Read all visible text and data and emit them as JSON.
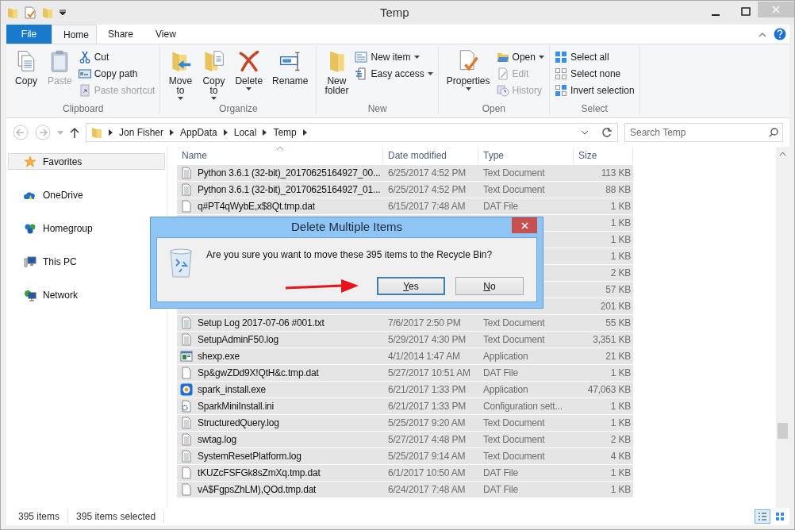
{
  "window": {
    "title": "Temp"
  },
  "ribbon_tabs": [
    {
      "label": "File",
      "kind": "file",
      "selected": false
    },
    {
      "label": "Home",
      "kind": "tab",
      "selected": true
    },
    {
      "label": "Share",
      "kind": "tab",
      "selected": false
    },
    {
      "label": "View",
      "kind": "tab",
      "selected": false
    }
  ],
  "ribbon_groups": [
    {
      "label": "Clipboard",
      "columns": [
        {
          "kind": "large",
          "items": [
            {
              "lines": [
                "Copy"
              ],
              "dropdown": false,
              "disabled": false
            }
          ]
        },
        {
          "kind": "large",
          "items": [
            {
              "lines": [
                "Paste"
              ],
              "dropdown": false,
              "disabled": true
            }
          ]
        },
        {
          "kind": "small",
          "items": [
            {
              "label": "Cut",
              "dropdown": false,
              "disabled": false
            },
            {
              "label": "Copy path",
              "dropdown": false,
              "disabled": false
            },
            {
              "label": "Paste shortcut",
              "dropdown": false,
              "disabled": true
            }
          ]
        }
      ]
    },
    {
      "label": "Organize",
      "columns": [
        {
          "kind": "large",
          "items": [
            {
              "lines": [
                "Move",
                "to"
              ],
              "dropdown": true,
              "disabled": false
            }
          ]
        },
        {
          "kind": "large",
          "items": [
            {
              "lines": [
                "Copy",
                "to"
              ],
              "dropdown": true,
              "disabled": false
            }
          ]
        },
        {
          "kind": "large",
          "items": [
            {
              "lines": [
                "Delete"
              ],
              "dropdown": true,
              "disabled": false
            }
          ]
        },
        {
          "kind": "large",
          "items": [
            {
              "lines": [
                "Rename"
              ],
              "dropdown": false,
              "disabled": false
            }
          ]
        }
      ]
    },
    {
      "label": "New",
      "columns": [
        {
          "kind": "large",
          "items": [
            {
              "lines": [
                "New",
                "folder"
              ],
              "dropdown": false,
              "disabled": false
            }
          ]
        },
        {
          "kind": "small",
          "items": [
            {
              "label": "New item",
              "dropdown": true,
              "disabled": false
            },
            {
              "label": "Easy access",
              "dropdown": true,
              "disabled": false
            }
          ]
        }
      ]
    },
    {
      "label": "Open",
      "columns": [
        {
          "kind": "large",
          "items": [
            {
              "lines": [
                "Properties"
              ],
              "dropdown": true,
              "disabled": false
            }
          ]
        },
        {
          "kind": "small",
          "items": [
            {
              "label": "Open",
              "dropdown": true,
              "disabled": false
            },
            {
              "label": "Edit",
              "dropdown": false,
              "disabled": true
            },
            {
              "label": "History",
              "dropdown": false,
              "disabled": true
            }
          ]
        }
      ]
    },
    {
      "label": "Select",
      "columns": [
        {
          "kind": "small",
          "items": [
            {
              "label": "Select all",
              "dropdown": false,
              "disabled": false
            },
            {
              "label": "Select none",
              "dropdown": false,
              "disabled": false
            },
            {
              "label": "Invert selection",
              "dropdown": false,
              "disabled": false
            }
          ]
        }
      ]
    }
  ],
  "address": {
    "crumbs": [
      "Jon Fisher",
      "AppData",
      "Local",
      "Temp"
    ]
  },
  "search": {
    "placeholder": "Search Temp"
  },
  "nav": [
    {
      "label": "Favorites",
      "kind": "star",
      "selected": true
    },
    {
      "label": "OneDrive",
      "kind": "cloud",
      "selected": false
    },
    {
      "label": "Homegroup",
      "kind": "group",
      "selected": false
    },
    {
      "label": "This PC",
      "kind": "pc",
      "selected": false
    },
    {
      "label": "Network",
      "kind": "network",
      "selected": false
    }
  ],
  "columns": [
    "Name",
    "Date modified",
    "Type",
    "Size"
  ],
  "rows": [
    {
      "kind": "text",
      "name": "Python 3.6.1 (32-bit)_20170625164927_00...",
      "date": "6/25/2017 4:52 PM",
      "type": "Text Document",
      "size": "113 KB",
      "selected": true
    },
    {
      "kind": "text",
      "name": "Python 3.6.1 (32-bit)_20170625164927_01...",
      "date": "6/25/2017 4:52 PM",
      "type": "Text Document",
      "size": "88 KB",
      "selected": true
    },
    {
      "kind": "dat",
      "name": "q#PT4qWybE,x$8Qt.tmp.dat",
      "date": "6/15/2017 7:48 AM",
      "type": "DAT File",
      "size": "1 KB",
      "selected": true
    },
    {
      "kind": "hidden",
      "size": "1 KB",
      "selected": true
    },
    {
      "kind": "hidden",
      "size": "1 KB",
      "selected": true
    },
    {
      "kind": "hidden",
      "size": "1 KB",
      "selected": true
    },
    {
      "kind": "hidden",
      "size": "2 KB",
      "selected": true
    },
    {
      "kind": "hidden",
      "size": "57 KB",
      "selected": true
    },
    {
      "kind": "hidden",
      "size": "201 KB",
      "selected": true
    },
    {
      "kind": "text",
      "name": "Setup Log 2017-07-06 #001.txt",
      "date": "7/6/2017 2:50 PM",
      "type": "Text Document",
      "size": "55 KB",
      "selected": true
    },
    {
      "kind": "text",
      "name": "SetupAdminF50.log",
      "date": "5/29/2017 4:30 PM",
      "type": "Text Document",
      "size": "3,351 KB",
      "selected": true
    },
    {
      "kind": "app",
      "name": "shexp.exe",
      "date": "4/1/2014 1:47 AM",
      "type": "Application",
      "size": "21 KB",
      "selected": true
    },
    {
      "kind": "dat",
      "name": "Sp&gwZDd9X!QtH&c.tmp.dat",
      "date": "5/27/2017 10:51 AM",
      "type": "DAT File",
      "size": "1 KB",
      "selected": true
    },
    {
      "kind": "installer",
      "name": "spark_install.exe",
      "date": "6/21/2017 1:33 PM",
      "type": "Application",
      "size": "47,063 KB",
      "selected": true
    },
    {
      "kind": "config",
      "name": "SparkMiniInstall.ini",
      "date": "6/21/2017 1:33 PM",
      "type": "Configuration sett...",
      "size": "1 KB",
      "selected": true
    },
    {
      "kind": "text",
      "name": "StructuredQuery.log",
      "date": "5/25/2017 9:20 AM",
      "type": "Text Document",
      "size": "1 KB",
      "selected": true
    },
    {
      "kind": "text",
      "name": "swtag.log",
      "date": "5/27/2017 4:48 PM",
      "type": "Text Document",
      "size": "2 KB",
      "selected": true
    },
    {
      "kind": "text",
      "name": "SystemResetPlatform.log",
      "date": "5/25/2017 9:14 AM",
      "type": "Text Document",
      "size": "4 KB",
      "selected": true
    },
    {
      "kind": "dat",
      "name": "tKUZcFSFGk8sZmXq.tmp.dat",
      "date": "6/1/2017 10:50 AM",
      "type": "DAT File",
      "size": "1 KB",
      "selected": true
    },
    {
      "kind": "dat",
      "name": "vA$FgpsZhLM),QOd.tmp.dat",
      "date": "6/24/2017 7:48 AM",
      "type": "DAT File",
      "size": "1 KB",
      "selected": true
    }
  ],
  "status_bar": [
    "395 items",
    "395 items selected"
  ],
  "views": [
    {
      "kind": "details",
      "selected": true
    },
    {
      "kind": "tiles",
      "selected": false
    }
  ],
  "dialog": {
    "title": "Delete Multiple Items",
    "message": "Are you sure you want to move these 395 items to the Recycle Bin?",
    "buttons": [
      {
        "label": "Yes",
        "default": true
      },
      {
        "label": "No",
        "default": false
      }
    ]
  }
}
